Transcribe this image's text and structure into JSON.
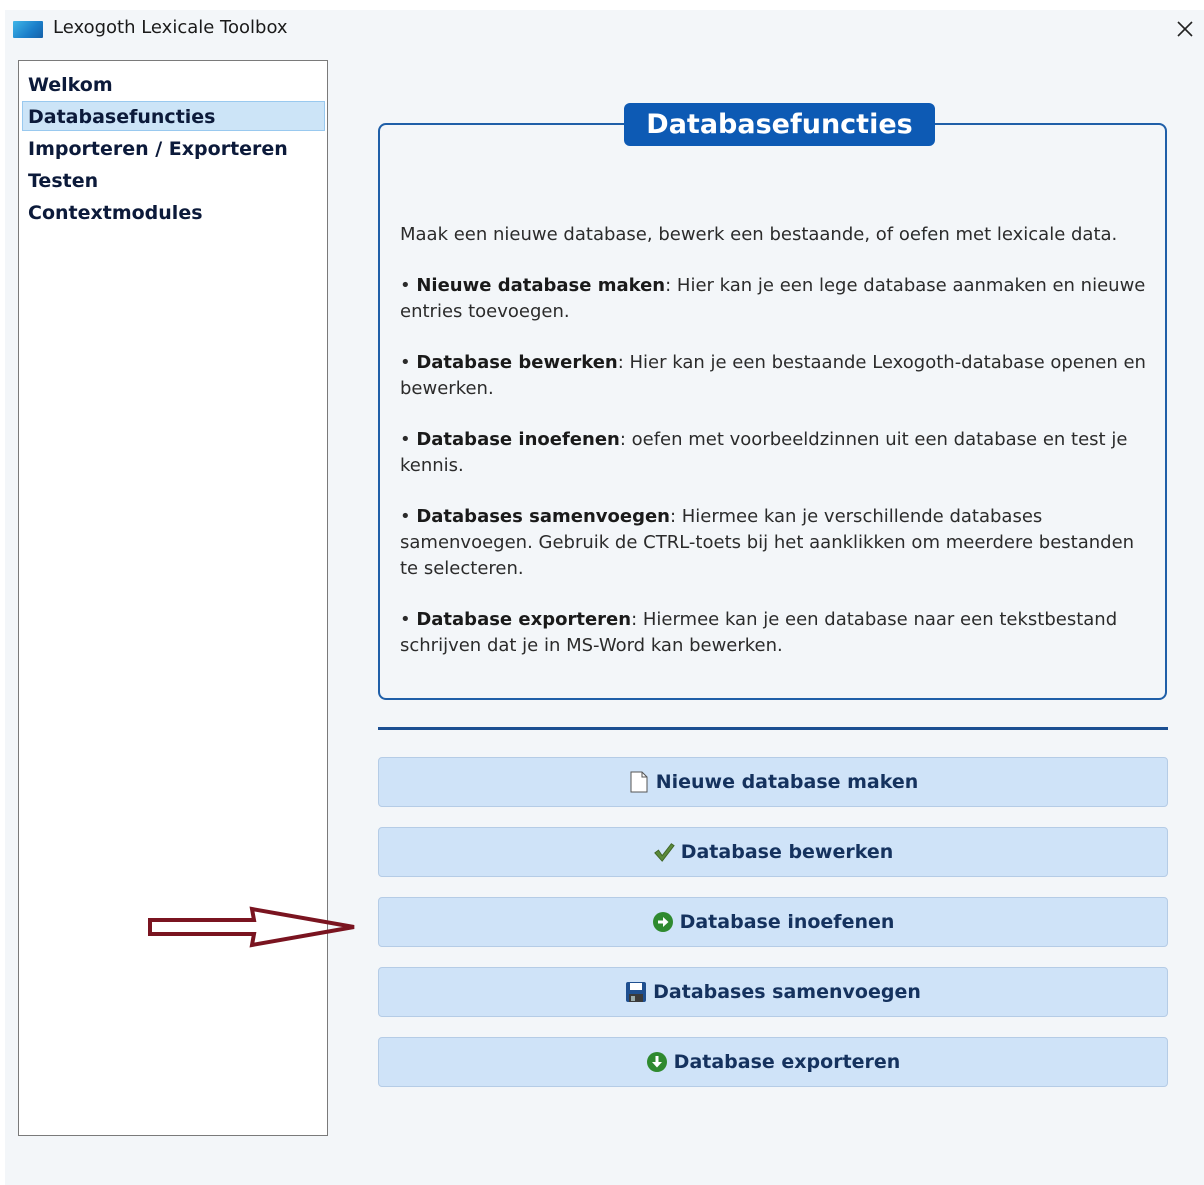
{
  "window": {
    "title": "Lexogoth Lexicale Toolbox",
    "close_glyph": "✕"
  },
  "sidebar": {
    "items": [
      {
        "label": "Welkom",
        "active": false
      },
      {
        "label": "Databasefuncties",
        "active": true
      },
      {
        "label": "Importeren / Exporteren",
        "active": false
      },
      {
        "label": "Testen",
        "active": false
      },
      {
        "label": "Contextmodules",
        "active": false
      }
    ]
  },
  "info": {
    "title": "Databasefuncties",
    "intro": "Maak een nieuwe database, bewerk een bestaande, of oefen met lexicale data.",
    "bullet_prefix": "• ",
    "bullets": [
      {
        "term": "Nieuwe database maken",
        "text": ": Hier kan je een lege database aanmaken en nieuwe entries toevoegen."
      },
      {
        "term": "Database bewerken",
        "text": ": Hier kan je een bestaande Lexogoth-database openen en bewerken."
      },
      {
        "term": "Database inoefenen",
        "text": ": oefen met voorbeeldzinnen uit een database en test je kennis."
      },
      {
        "term": "Databases samenvoegen",
        "text": ": Hiermee kan je verschillende databases samenvoegen. Gebruik de CTRL-toets bij het aanklikken om meerdere bestanden te selecteren."
      },
      {
        "term": "Database exporteren",
        "text": ": Hiermee kan je een database naar een tekstbestand schrijven dat je in MS-Word kan bewerken."
      }
    ]
  },
  "buttons": [
    {
      "label": "Nieuwe database maken",
      "icon": "blank-page-icon"
    },
    {
      "label": "Database bewerken",
      "icon": "checkmark-icon"
    },
    {
      "label": "Database inoefenen",
      "icon": "arrow-right-circle-icon"
    },
    {
      "label": "Databases samenvoegen",
      "icon": "floppy-disk-icon"
    },
    {
      "label": "Database exporteren",
      "icon": "arrow-down-circle-icon"
    }
  ],
  "colors": {
    "accent": "#0d5ab4",
    "button_bg": "#cfe3f8",
    "annotation_arrow": "#7a1420"
  }
}
